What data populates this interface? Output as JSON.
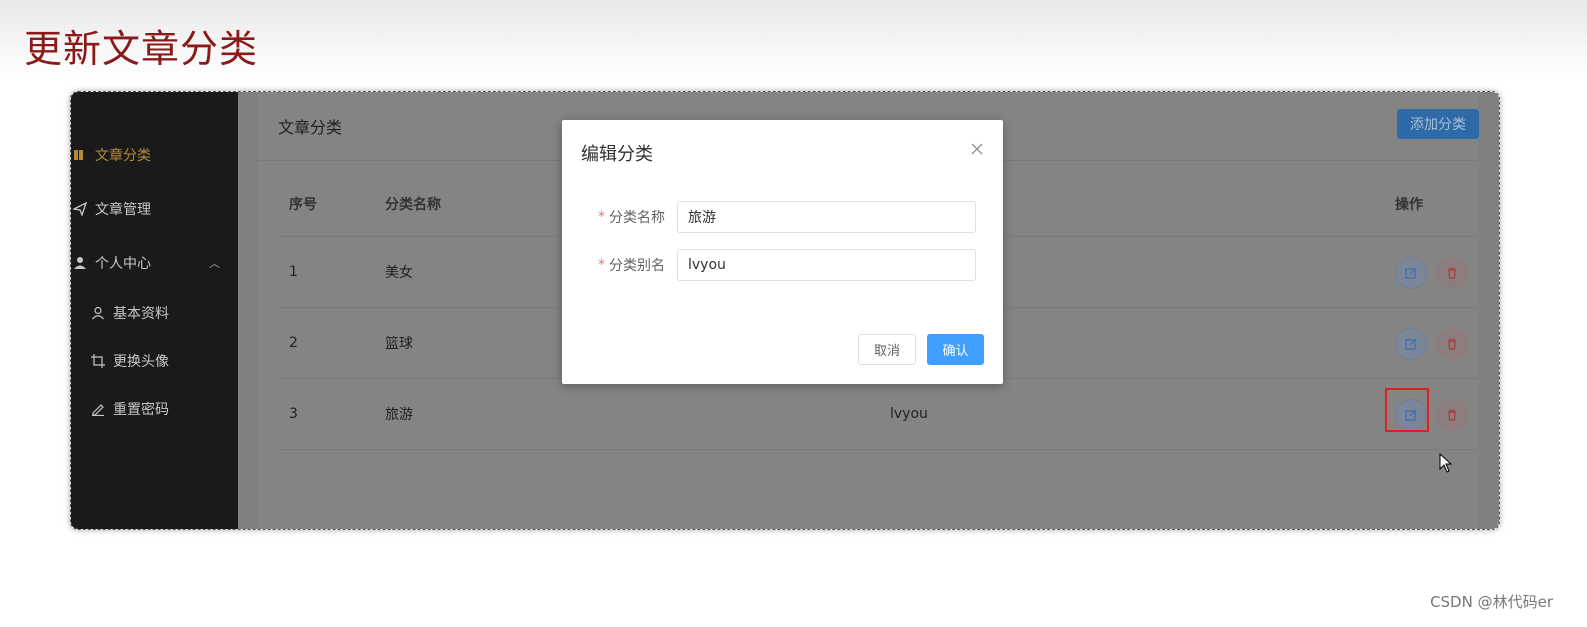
{
  "slide": {
    "title": "更新文章分类"
  },
  "sidebar": {
    "items": [
      {
        "label": "文章分类",
        "icon": "bookmark-icon",
        "active": true
      },
      {
        "label": "文章管理",
        "icon": "paper-plane-icon"
      },
      {
        "label": "个人中心",
        "icon": "user-icon",
        "expanded": true
      }
    ],
    "subitems": [
      {
        "label": "基本资料",
        "icon": "user-outline-icon"
      },
      {
        "label": "更换头像",
        "icon": "crop-icon"
      },
      {
        "label": "重置密码",
        "icon": "pen-icon"
      }
    ]
  },
  "card": {
    "title": "文章分类",
    "add_button": "添加分类"
  },
  "table": {
    "headers": {
      "idx": "序号",
      "name": "分类名称",
      "ops": "操作"
    },
    "rows": [
      {
        "idx": "1",
        "name": "美女",
        "alias": ""
      },
      {
        "idx": "2",
        "name": "篮球",
        "alias": ""
      },
      {
        "idx": "3",
        "name": "旅游",
        "alias": "lvyou"
      }
    ]
  },
  "dialog": {
    "title": "编辑分类",
    "fields": [
      {
        "label": "分类名称",
        "value": "旅游"
      },
      {
        "label": "分类别名",
        "value": "lvyou"
      }
    ],
    "cancel": "取消",
    "confirm": "确认"
  },
  "colors": {
    "accent": "#409eff",
    "title": "#8a1a1a",
    "active_nav": "#b88a35",
    "required": "#f56c6c"
  },
  "watermark": "CSDN @林代码er"
}
